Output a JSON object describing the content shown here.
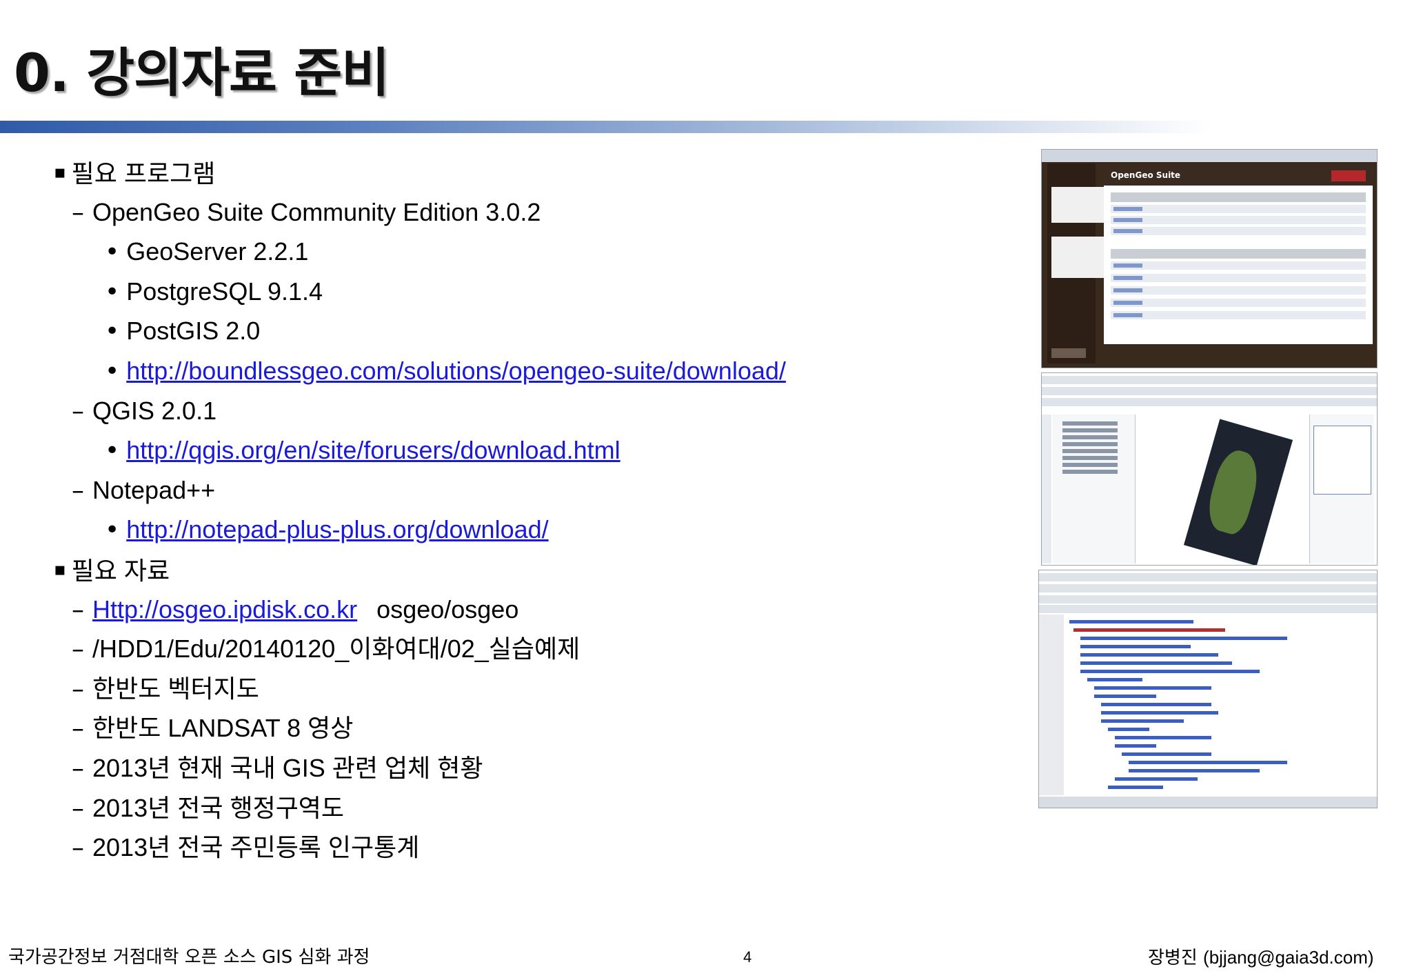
{
  "title": "0. 강의자료 준비",
  "outline": [
    {
      "level": 1,
      "text": "필요 프로그램"
    },
    {
      "level": 2,
      "text": "OpenGeo Suite Community Edition 3.0.2"
    },
    {
      "level": 3,
      "text": "GeoServer 2.2.1"
    },
    {
      "level": 3,
      "text": "PostgreSQL 9.1.4"
    },
    {
      "level": 3,
      "text": "PostGIS 2.0"
    },
    {
      "level": 3,
      "link": "http://boundlessgeo.com/solutions/opengeo-suite/download/"
    },
    {
      "level": 2,
      "text": "QGIS 2.0.1"
    },
    {
      "level": 3,
      "link": "http://qgis.org/en/site/forusers/download.html"
    },
    {
      "level": 2,
      "text": "Notepad++"
    },
    {
      "level": 3,
      "link": "http://notepad-plus-plus.org/download/"
    },
    {
      "level": 1,
      "text": "필요 자료"
    },
    {
      "level": 2,
      "link": "Http://osgeo.ipdisk.co.kr",
      "after": "osgeo/osgeo"
    },
    {
      "level": 2,
      "text": "/HDD1/Edu/20140120_이화여대/02_실습예제"
    },
    {
      "level": 2,
      "text": "한반도 벡터지도"
    },
    {
      "level": 2,
      "text": "한반도 LANDSAT 8 영상"
    },
    {
      "level": 2,
      "text": "2013년 현재 국내 GIS 관련 업체 현황"
    },
    {
      "level": 2,
      "text": "2013년 전국 행정구역도"
    },
    {
      "level": 2,
      "text": "2013년 전국 주민등록 인구통계"
    }
  ],
  "markers": {
    "level1": "▪",
    "level2": "–",
    "level3": "•"
  },
  "screenshots": {
    "opengeo": {
      "header_label": "OpenGeo Suite"
    }
  },
  "footer": {
    "left": "국가공간정보 거점대학 오픈 소스 GIS 심화 과정",
    "page_number": "4",
    "author": "장병진",
    "email": "(bjjang@gaia3d.com)"
  },
  "colors": {
    "link": "#1a1adb",
    "title_bar": "#2f5ba8"
  }
}
